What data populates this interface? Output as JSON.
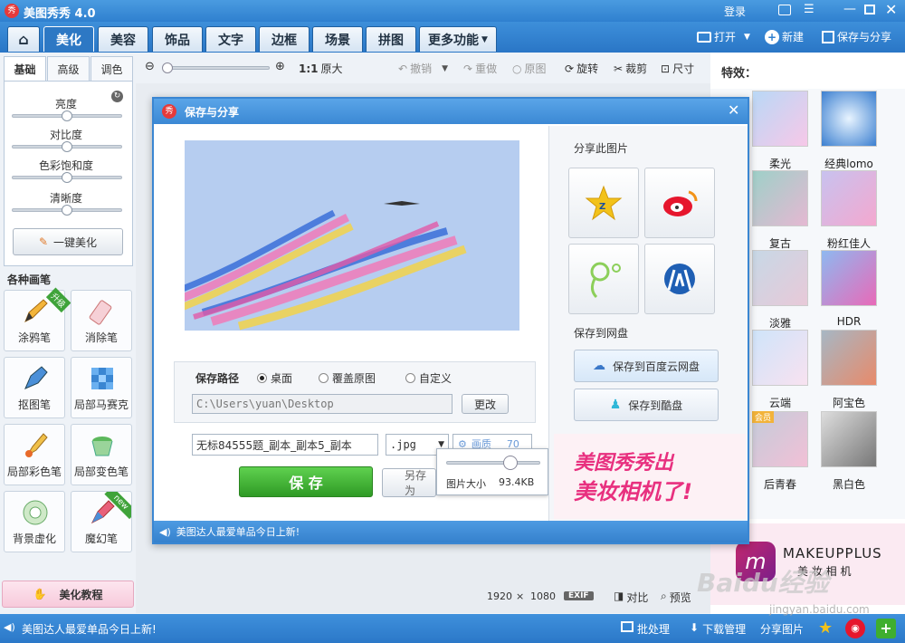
{
  "app": {
    "title": "美图秀秀 4.0",
    "login": "登录"
  },
  "tabs": [
    {
      "label": "美化"
    },
    {
      "label": "美容"
    },
    {
      "label": "饰品"
    },
    {
      "label": "文字"
    },
    {
      "label": "边框"
    },
    {
      "label": "场景"
    },
    {
      "label": "拼图"
    },
    {
      "label": "更多功能"
    }
  ],
  "topActions": {
    "open": "打开",
    "new": "新建",
    "saveShare": "保存与分享"
  },
  "toolbar": {
    "ratio": "1:1",
    "original_size": "原大",
    "undo": "撤销",
    "redo": "重做",
    "original": "原图",
    "rotate": "旋转",
    "crop": "裁剪",
    "resize": "尺寸"
  },
  "leftTabs": [
    {
      "label": "基础"
    },
    {
      "label": "高级"
    },
    {
      "label": "调色"
    }
  ],
  "sliders": [
    {
      "label": "亮度",
      "value": 0.5
    },
    {
      "label": "对比度",
      "value": 0.5
    },
    {
      "label": "色彩饱和度",
      "value": 0.5
    },
    {
      "label": "清晰度",
      "value": 0.5
    }
  ],
  "oneClick": "一键美化",
  "brushesTitle": "各种画笔",
  "brushes": [
    {
      "label": "涂鸦笔",
      "badge": "升级"
    },
    {
      "label": "消除笔"
    },
    {
      "label": "抠图笔"
    },
    {
      "label": "局部马赛克"
    },
    {
      "label": "局部彩色笔"
    },
    {
      "label": "局部变色笔"
    },
    {
      "label": "背景虚化"
    },
    {
      "label": "魔幻笔",
      "badge": "new"
    }
  ],
  "tutorial": "美化教程",
  "effects": {
    "title": "特效：",
    "items": [
      {
        "label": "柔光"
      },
      {
        "label": "经典lomo"
      },
      {
        "label": "复古"
      },
      {
        "label": "粉红佳人"
      },
      {
        "label": "淡雅"
      },
      {
        "label": "HDR"
      },
      {
        "label": "云端"
      },
      {
        "label": "阿宝色"
      },
      {
        "label": "后青春",
        "badge": "会员"
      },
      {
        "label": "黑白色"
      }
    ],
    "ad": {
      "brand": "MAKEUPPLUS",
      "sub": "美 妆 相 机"
    }
  },
  "canvasInfo": {
    "width": "1920",
    "times": "×",
    "height": "1080",
    "exif": "EXIF",
    "compare": "对比",
    "preview": "预览"
  },
  "dialog": {
    "title": "保存与分享",
    "shareTitle": "分享此图片",
    "cloudTitle": "保存到网盘",
    "baidu": "保存到百度云网盘",
    "kuaipan": "保存到酷盘",
    "pathLabel": "保存路径",
    "options": [
      {
        "label": "桌面",
        "checked": true
      },
      {
        "label": "覆盖原图",
        "checked": false
      },
      {
        "label": "自定义",
        "checked": false
      }
    ],
    "path": "C:\\Users\\yuan\\Desktop",
    "change": "更改",
    "filename": "无标84555题_副本_副本5_副本",
    "ext": ".jpg",
    "qualityLabel": "画质",
    "quality": "70",
    "sizeLabel": "图片大小",
    "size": "93.4KB",
    "save": "保 存",
    "saveAs": "另存为",
    "news": "美图达人最爱单品今日上新!",
    "promo1": "美图秀秀出",
    "promo2": "美妆相机了!"
  },
  "status": {
    "news": "美图达人最爱单品今日上新!",
    "batch": "批处理",
    "download": "下载管理",
    "share": "分享图片"
  },
  "watermark": {
    "text": "Baidu经验",
    "url": "jingyan.baidu.com"
  },
  "colors": {
    "accent": "#2f80cf",
    "save": "#3fae2f",
    "promo": "#e8307f"
  }
}
